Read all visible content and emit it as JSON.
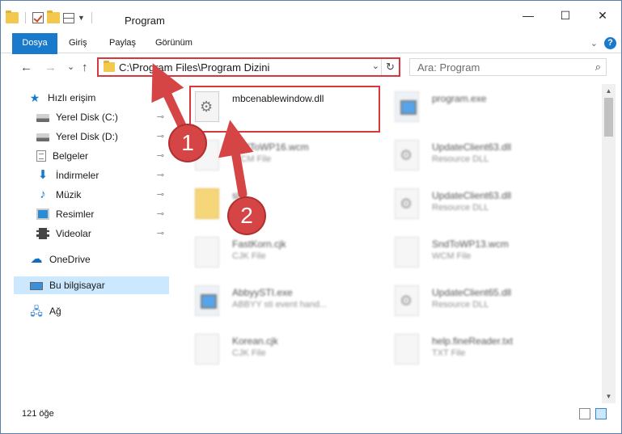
{
  "window": {
    "title": "Program",
    "controls": {
      "minimize": "—",
      "maximize": "☐",
      "close": "✕"
    }
  },
  "ribbon": {
    "tabs": [
      "Dosya",
      "Giriş",
      "Paylaş",
      "Görünüm"
    ],
    "help": "?"
  },
  "navigation": {
    "back": "←",
    "forward": "→",
    "recent": "⌄",
    "up": "↑",
    "address": "C:\\Program Files\\Program Dizini",
    "refresh": "↻",
    "search_placeholder": "Ara: Program"
  },
  "sidebar": {
    "items": [
      {
        "label": "Hızlı erişim",
        "icon": "quick-access-star-icon",
        "pinned": false
      },
      {
        "label": "Yerel Disk (C:)",
        "icon": "drive-icon",
        "pinned": true
      },
      {
        "label": "Yerel Disk (D:)",
        "icon": "drive-icon",
        "pinned": true
      },
      {
        "label": "Belgeler",
        "icon": "documents-icon",
        "pinned": true
      },
      {
        "label": "İndirmeler",
        "icon": "downloads-icon",
        "pinned": true
      },
      {
        "label": "Müzik",
        "icon": "music-icon",
        "pinned": true
      },
      {
        "label": "Resimler",
        "icon": "pictures-icon",
        "pinned": true
      },
      {
        "label": "Videolar",
        "icon": "videos-icon",
        "pinned": true
      },
      {
        "label": "OneDrive",
        "icon": "onedrive-cloud-icon",
        "pinned": false
      },
      {
        "label": "Bu bilgisayar",
        "icon": "this-pc-icon",
        "pinned": false,
        "selected": true
      },
      {
        "label": "Ağ",
        "icon": "network-icon",
        "pinned": false
      }
    ],
    "pin_glyph": "📌"
  },
  "files": [
    {
      "name": "mbcenablewindow.dll",
      "type": "",
      "icon": "dll-gear-icon",
      "highlighted": true
    },
    {
      "name": "program.exe",
      "type": "",
      "icon": "exe-icon"
    },
    {
      "name": "SndToWP16.wcm",
      "type": "WCM File",
      "icon": "file-icon"
    },
    {
      "name": "UpdateClient63.dll",
      "type": "Resource DLL",
      "icon": "dll-gear-icon"
    },
    {
      "name": "sl",
      "type": "",
      "icon": "folder-icon"
    },
    {
      "name": "UpdateClient63.dll",
      "type": "Resource DLL",
      "icon": "dll-gear-icon"
    },
    {
      "name": "FastKorn.cjk",
      "type": "CJK File",
      "icon": "file-icon"
    },
    {
      "name": "SndToWP13.wcm",
      "type": "WCM File",
      "icon": "file-icon"
    },
    {
      "name": "AbbyySTI.exe",
      "type": "ABBYY sti event hand...",
      "icon": "exe-icon"
    },
    {
      "name": "UpdateClient65.dll",
      "type": "Resource DLL",
      "icon": "dll-gear-icon"
    },
    {
      "name": "Korean.cjk",
      "type": "CJK File",
      "icon": "file-icon"
    },
    {
      "name": "help.fineReader.txt",
      "type": "TXT File",
      "icon": "file-icon"
    }
  ],
  "status": {
    "item_count": "121 öğe"
  },
  "annotations": {
    "step1": "1",
    "step2": "2",
    "accent": "#d9363e"
  }
}
